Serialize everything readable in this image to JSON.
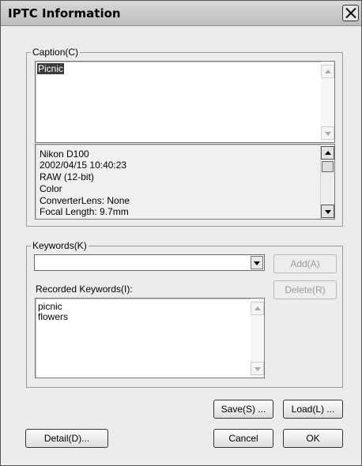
{
  "window": {
    "title": "IPTC Information"
  },
  "caption": {
    "group_label": "Caption(C)",
    "text": "Picnic"
  },
  "info_lines": [
    "Nikon D100",
    "2002/04/15 10:40:23",
    "RAW (12-bit)",
    "Color",
    "ConverterLens: None",
    "Focal Length: 9.7mm"
  ],
  "keywords": {
    "group_label": "Keywords(K)",
    "combo_value": "",
    "add_label": "Add(A)",
    "delete_label": "Delete(R)",
    "recorded_label": "Recorded Keywords(I):",
    "recorded": [
      "picnic",
      "flowers"
    ]
  },
  "buttons": {
    "save": "Save(S) ...",
    "load": "Load(L) ...",
    "detail": "Detail(D)...",
    "cancel": "Cancel",
    "ok": "OK"
  }
}
